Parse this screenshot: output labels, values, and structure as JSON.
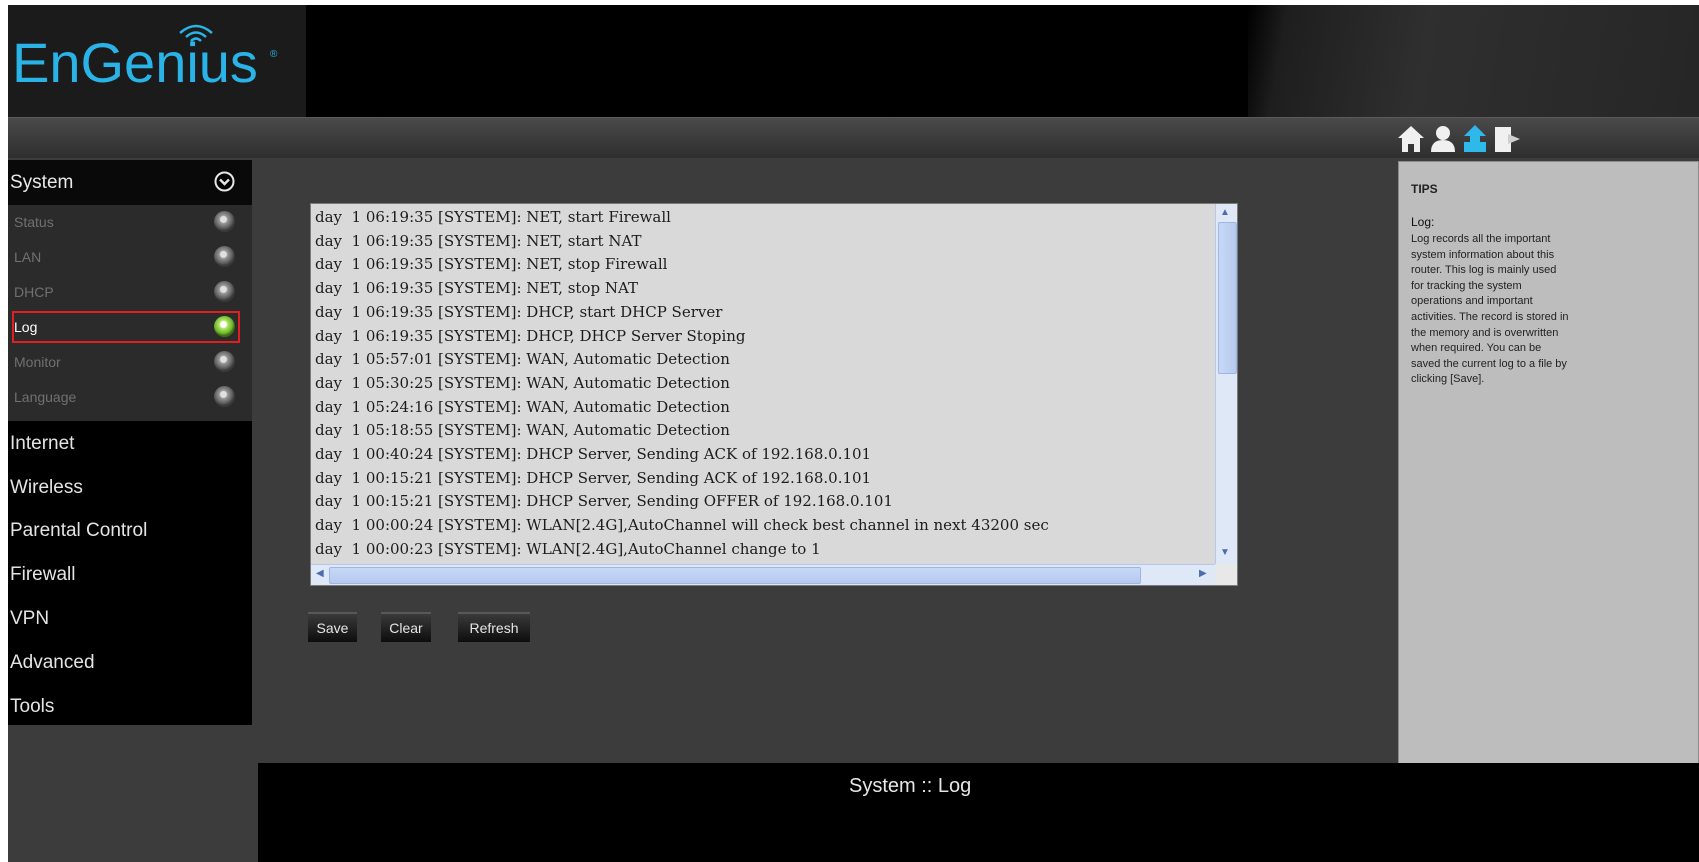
{
  "brand": {
    "name": "EnGenius",
    "registered": "®"
  },
  "top_icons": [
    "home-icon",
    "user-icon",
    "upgrade-icon",
    "logout-icon"
  ],
  "sidebar": {
    "section": "System",
    "sub_items": [
      {
        "label": "Status",
        "active": false
      },
      {
        "label": "LAN",
        "active": false
      },
      {
        "label": "DHCP",
        "active": false
      },
      {
        "label": "Log",
        "active": true
      },
      {
        "label": "Monitor",
        "active": false
      },
      {
        "label": "Language",
        "active": false
      }
    ],
    "main_items": [
      "Internet",
      "Wireless",
      "Parental Control",
      "Firewall",
      "VPN",
      "Advanced",
      "Tools"
    ]
  },
  "log": {
    "lines": [
      "day  1 06:19:35 [SYSTEM]: NET, start Firewall",
      "day  1 06:19:35 [SYSTEM]: NET, start NAT",
      "day  1 06:19:35 [SYSTEM]: NET, stop Firewall",
      "day  1 06:19:35 [SYSTEM]: NET, stop NAT",
      "day  1 06:19:35 [SYSTEM]: DHCP, start DHCP Server",
      "day  1 06:19:35 [SYSTEM]: DHCP, DHCP Server Stoping",
      "day  1 05:57:01 [SYSTEM]: WAN, Automatic Detection",
      "day  1 05:30:25 [SYSTEM]: WAN, Automatic Detection",
      "day  1 05:24:16 [SYSTEM]: WAN, Automatic Detection",
      "day  1 05:18:55 [SYSTEM]: WAN, Automatic Detection",
      "day  1 00:40:24 [SYSTEM]: DHCP Server, Sending ACK of 192.168.0.101",
      "day  1 00:15:21 [SYSTEM]: DHCP Server, Sending ACK of 192.168.0.101",
      "day  1 00:15:21 [SYSTEM]: DHCP Server, Sending OFFER of 192.168.0.101",
      "day  1 00:00:24 [SYSTEM]: WLAN[2.4G],AutoChannel will check best channel in next 43200 sec",
      "day  1 00:00:23 [SYSTEM]: WLAN[2.4G],AutoChannel change to 1"
    ]
  },
  "buttons": {
    "save": "Save",
    "clear": "Clear",
    "refresh": "Refresh"
  },
  "tips": {
    "title": "TIPS",
    "subtitle": "Log:",
    "body": "Log records all the important system information about this router. This log is mainly used for tracking the system operations and important activities. The record is stored in the memory and is overwritten when required. You can be saved the current log to a file by clicking [Save]."
  },
  "footer": {
    "breadcrumb": "System :: Log"
  },
  "colors": {
    "accent": "#29b3e6",
    "active_dot": "#6fb52b",
    "highlight": "#e02020"
  }
}
